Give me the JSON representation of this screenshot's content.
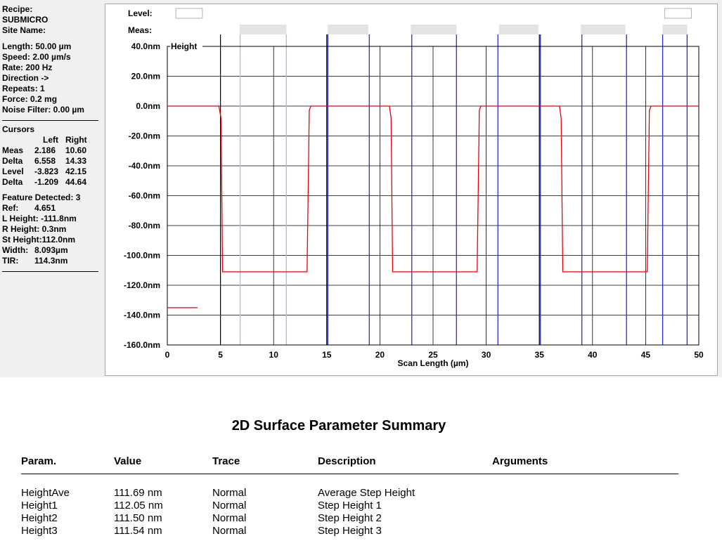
{
  "info": {
    "recipe_label": "Recipe:",
    "recipe": "SUBMICRO",
    "site_label": "Site Name:",
    "scan_params": [
      "Length: 50.00 µm",
      "Speed: 2.00 µm/s",
      "Rate: 200 Hz",
      "Direction ->",
      "Repeats: 1",
      "Force: 0.2 mg",
      "Noise Filter: 0.00 µm"
    ]
  },
  "cursors": {
    "title": "Cursors",
    "col_left": "Left",
    "col_right": "Right",
    "rows": [
      {
        "label": "Meas",
        "left": "2.186",
        "right": "10.60"
      },
      {
        "label": "Delta",
        "left": "6.558",
        "right": "14.33"
      },
      {
        "label": "Level",
        "left": "-3.823",
        "right": "42.15"
      },
      {
        "label": "Delta",
        "left": "-1.209",
        "right": "44.64"
      }
    ]
  },
  "features": {
    "detected": "Feature Detected: 3",
    "rows": [
      {
        "label": "Ref:",
        "value": "4.651"
      },
      {
        "label": "L Height:",
        "value": "-111.8nm"
      },
      {
        "label": "R Height:",
        "value": "0.3nm"
      },
      {
        "label": "St Height:",
        "value": "112.0nm"
      },
      {
        "label": "Width:",
        "value": "8.093µm"
      },
      {
        "label": "TIR:",
        "value": "114.3nm"
      }
    ]
  },
  "chart_data": {
    "type": "line",
    "series_label": "Height",
    "level_label": "Level:",
    "meas_label": "Meas:",
    "xlabel": "Scan Length (µm)",
    "ylabel": "",
    "xlim": [
      0,
      50
    ],
    "ylim": [
      -160,
      40
    ],
    "x_ticks": [
      "0",
      "5",
      "10",
      "15",
      "20",
      "25",
      "30",
      "35",
      "40",
      "45",
      "50"
    ],
    "y_ticks": [
      "40.0nm",
      "20.0nm",
      "0.0nm",
      "-20.0nm",
      "-40.0nm",
      "-60.0nm",
      "-80.0nm",
      "-100.0nm",
      "-120.0nm",
      "-140.0nm",
      "-160.0nm"
    ],
    "grid": true,
    "profile_color": "#e8000b",
    "profile": [
      [
        0,
        0
      ],
      [
        4.85,
        0
      ],
      [
        5.05,
        -8
      ],
      [
        5.2,
        -111
      ],
      [
        13.15,
        -111
      ],
      [
        13.35,
        -3
      ],
      [
        13.5,
        0
      ],
      [
        20.9,
        0
      ],
      [
        21.05,
        -8
      ],
      [
        21.2,
        -111
      ],
      [
        29.15,
        -111
      ],
      [
        29.35,
        -3
      ],
      [
        29.5,
        0
      ],
      [
        36.9,
        0
      ],
      [
        37.05,
        -8
      ],
      [
        37.2,
        -111
      ],
      [
        45.15,
        -111
      ],
      [
        45.35,
        -3
      ],
      [
        45.5,
        0
      ],
      [
        50,
        0
      ]
    ],
    "stray_segment": {
      "x": [
        0,
        2.85
      ],
      "y": -135
    },
    "black_cursors": [
      5,
      15,
      35
    ],
    "pink_cursors": [
      6.85,
      11.2
    ],
    "blue_cursors": [
      15.1,
      19,
      23,
      27.2,
      31.1,
      35.1,
      39,
      43.2,
      46.6,
      48.9
    ],
    "level_boxes": [
      [
        0.8,
        3.3
      ],
      [
        46.8,
        49.3
      ]
    ],
    "meas_boxes": [
      [
        6.8,
        11.2
      ],
      [
        15.1,
        18.9
      ],
      [
        22.9,
        27.2
      ],
      [
        31.2,
        34.9
      ],
      [
        38.9,
        43.1
      ],
      [
        46.6,
        48.9
      ]
    ]
  },
  "summary": {
    "title": "2D Surface Parameter Summary",
    "headers": {
      "param": "Param.",
      "value": "Value",
      "trace": "Trace",
      "description": "Description",
      "arguments": "Arguments"
    },
    "rows": [
      {
        "param": "HeightAve",
        "value": "111.69  nm",
        "trace": "Normal",
        "description": "Average Step Height"
      },
      {
        "param": "Height1",
        "value": "112.05  nm",
        "trace": "Normal",
        "description": "Step Height 1"
      },
      {
        "param": "Height2",
        "value": "111.50  nm",
        "trace": "Normal",
        "description": "Step Height 2"
      },
      {
        "param": "Height3",
        "value": "111.54  nm",
        "trace": "Normal",
        "description": "Step Height 3"
      }
    ]
  }
}
